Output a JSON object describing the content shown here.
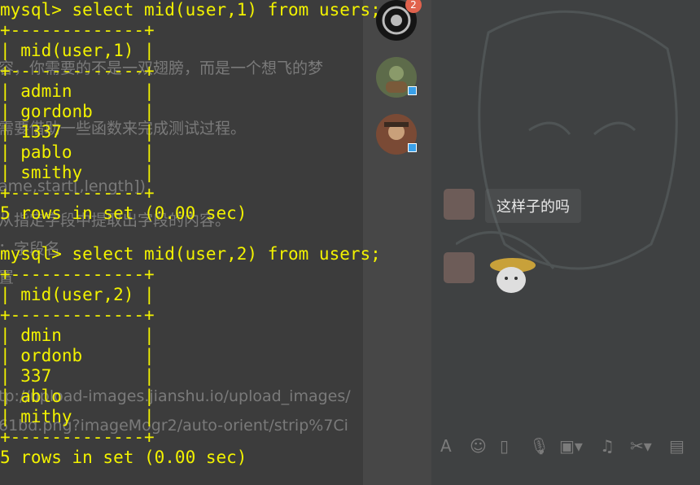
{
  "document": {
    "lines": [
      "容，你需要的不是一双翅膀，而是一个想飞的梦",
      "需要借助一些函数来完成测试过程。",
      "ame,start[,length])",
      "从指定字段中提取出字段的内容。",
      "：字段名",
      "置",
      "tp://upload-images.jianshu.io/upload_images/",
      "61bd.png?imageMogr2/auto-orient/strip%7Ci"
    ]
  },
  "sidebar": {
    "badge_count": "2"
  },
  "chat": {
    "message": "这样子的吗"
  },
  "toolbar": {
    "icons": [
      "font-icon",
      "emoji-icon",
      "shake-icon",
      "microphone-icon",
      "image-icon",
      "music-icon",
      "scissors-icon",
      "calendar-icon"
    ]
  },
  "terminal": {
    "lines": [
      "mysql> select mid(user,1) from users;",
      "+-------------+",
      "| mid(user,1) |",
      "+-------------+",
      "| admin       |",
      "| gordonb     |",
      "| 1337        |",
      "| pablo       |",
      "| smithy      |",
      "+-------------+",
      "5 rows in set (0.00 sec)",
      "",
      "mysql> select mid(user,2) from users;",
      "+-------------+",
      "| mid(user,2) |",
      "+-------------+",
      "| dmin        |",
      "| ordonb      |",
      "| 337         |",
      "| ablo        |",
      "| mithy       |",
      "+-------------+",
      "5 rows in set (0.00 sec)"
    ]
  },
  "colors": {
    "terminal_text": "#f2f200",
    "badge": "#e1624d"
  }
}
